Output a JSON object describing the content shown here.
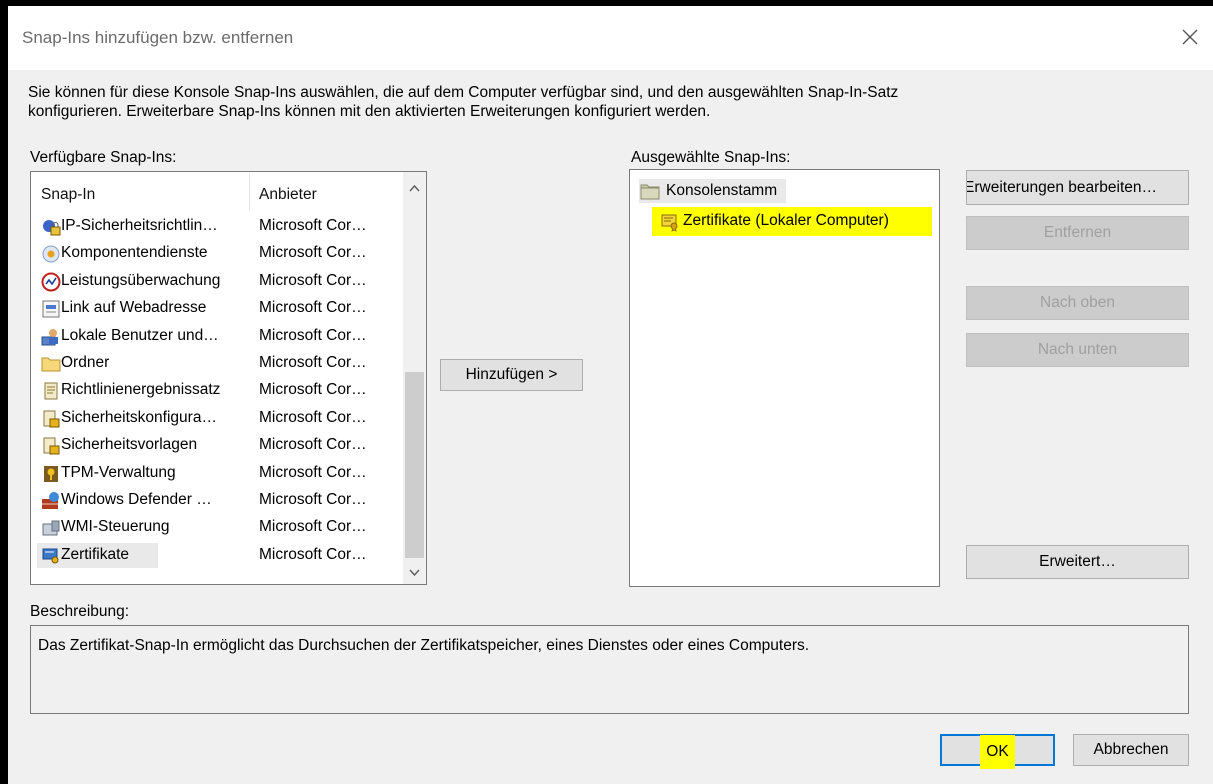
{
  "window": {
    "title": "Snap-Ins hinzufügen bzw. entfernen"
  },
  "intro": {
    "line1": "Sie können für diese Konsole Snap-Ins auswählen, die auf dem Computer verfügbar sind, und den ausgewählten Snap-In-Satz",
    "line2": "konfigurieren. Erweiterbare Snap-Ins können mit den aktivierten Erweiterungen konfiguriert werden."
  },
  "available": {
    "label": "Verfügbare Snap-Ins:",
    "columns": {
      "name": "Snap-In",
      "provider": "Anbieter"
    },
    "items": [
      {
        "name": "IP-Sicherheitsrichtlin…",
        "provider": "Microsoft Cor…",
        "icon": "ip-security-icon"
      },
      {
        "name": "Komponentendienste",
        "provider": "Microsoft Cor…",
        "icon": "component-services-icon"
      },
      {
        "name": "Leistungsüberwachung",
        "provider": "Microsoft Cor…",
        "icon": "performance-monitor-icon"
      },
      {
        "name": "Link auf Webadresse",
        "provider": "Microsoft Cor…",
        "icon": "web-link-icon"
      },
      {
        "name": "Lokale Benutzer und…",
        "provider": "Microsoft Cor…",
        "icon": "local-users-icon"
      },
      {
        "name": "Ordner",
        "provider": "Microsoft Cor…",
        "icon": "folder-icon"
      },
      {
        "name": "Richtlinienergebnissatz",
        "provider": "Microsoft Cor…",
        "icon": "policy-result-icon"
      },
      {
        "name": "Sicherheitskonfigura…",
        "provider": "Microsoft Cor…",
        "icon": "security-config-icon"
      },
      {
        "name": "Sicherheitsvorlagen",
        "provider": "Microsoft Cor…",
        "icon": "security-templates-icon"
      },
      {
        "name": "TPM-Verwaltung",
        "provider": "Microsoft Cor…",
        "icon": "tpm-icon"
      },
      {
        "name": "Windows Defender …",
        "provider": "Microsoft Cor…",
        "icon": "firewall-icon"
      },
      {
        "name": "WMI-Steuerung",
        "provider": "Microsoft Cor…",
        "icon": "wmi-icon"
      },
      {
        "name": "Zertifikate",
        "provider": "Microsoft Cor…",
        "icon": "certificate-icon"
      }
    ]
  },
  "add_button": "Hinzufügen >",
  "selected": {
    "label": "Ausgewählte Snap-Ins:",
    "root": "Konsolenstamm",
    "child": "Zertifikate (Lokaler Computer)"
  },
  "side_buttons": {
    "edit_extensions": "Erweiterungen bearbeiten…",
    "remove": "Entfernen",
    "move_up": "Nach oben",
    "move_down": "Nach unten",
    "advanced": "Erweitert…"
  },
  "description": {
    "label": "Beschreibung:",
    "text": "Das Zertifikat-Snap-In ermöglicht das Durchsuchen der Zertifikatspeicher, eines Dienstes oder eines Computers."
  },
  "footer": {
    "ok": "OK",
    "cancel": "Abbrechen"
  },
  "colors": {
    "highlight": "#ffff00",
    "accent": "#0078d7"
  }
}
